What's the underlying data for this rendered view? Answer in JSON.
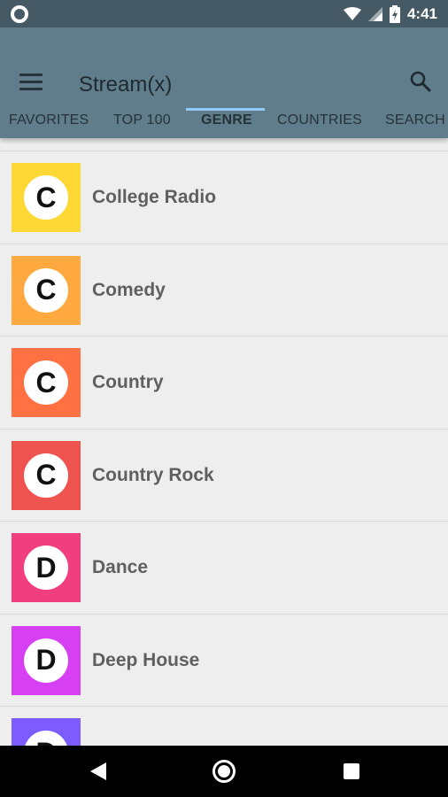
{
  "status_bar": {
    "time": "4:41",
    "icons": [
      "notification-circle-icon",
      "wifi-icon",
      "signal-icon",
      "battery-icon"
    ]
  },
  "app_bar": {
    "title": "Stream(x)",
    "menu_icon": "hamburger-menu-icon",
    "search_icon": "search-icon",
    "background": "#607d8b"
  },
  "tabs": [
    {
      "label": "FAVORITES",
      "active": false
    },
    {
      "label": "TOP 100",
      "active": false
    },
    {
      "label": "GENRE",
      "active": true
    },
    {
      "label": "COUNTRIES",
      "active": false
    },
    {
      "label": "SEARCH",
      "active": false
    }
  ],
  "genres": [
    {
      "letter": "C",
      "label": "College Radio",
      "color": "#fdd835"
    },
    {
      "letter": "C",
      "label": "Comedy",
      "color": "#ffa940"
    },
    {
      "letter": "C",
      "label": "Country",
      "color": "#ff7043"
    },
    {
      "letter": "C",
      "label": "Country Rock",
      "color": "#ef5350"
    },
    {
      "letter": "D",
      "label": "Dance",
      "color": "#f03e7e"
    },
    {
      "letter": "D",
      "label": "Deep House",
      "color": "#d63ff2"
    },
    {
      "letter": "D",
      "label": "",
      "color": "#7c5cff"
    }
  ],
  "nav_bar": {
    "icons": [
      "back-icon",
      "home-icon",
      "recents-icon"
    ]
  }
}
